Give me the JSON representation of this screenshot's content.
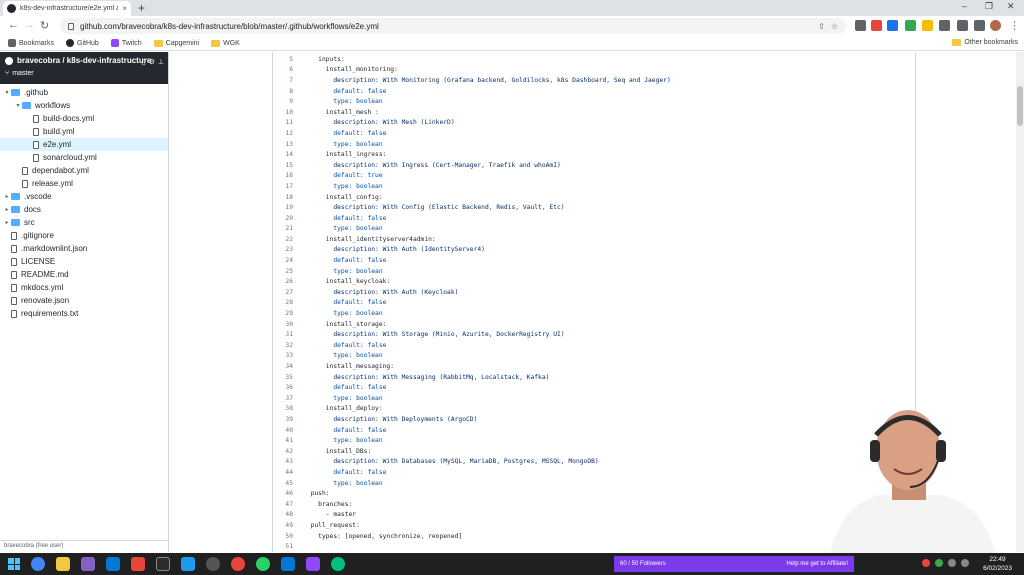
{
  "browser": {
    "tab_title": "k8s-dev-infrastructure/e2e.yml a",
    "tab_close": "×",
    "new_tab": "+",
    "url": "github.com/bravecobra/k8s-dev-infrastructure/blob/master/.github/workflows/e2e.yml",
    "bookmarks": [
      {
        "label": "Bookmarks",
        "color": "#5f6368"
      },
      {
        "label": "GitHub",
        "color": "#24292f"
      },
      {
        "label": "Twitch",
        "color": "#9146ff"
      },
      {
        "label": "Capgemini",
        "color": "#f6c744"
      },
      {
        "label": "WGK",
        "color": "#f6c744"
      }
    ],
    "other_bookmarks": "Other bookmarks"
  },
  "sidebar": {
    "repo": "bravecobra / k8s-dev-infrastructure",
    "branch": "master",
    "footer": "bravecobra (free user)",
    "tree": [
      {
        "label": ".github",
        "type": "folder",
        "depth": 0,
        "open": true
      },
      {
        "label": "workflows",
        "type": "folder",
        "depth": 1,
        "open": true
      },
      {
        "label": "build-docs.yml",
        "type": "file",
        "depth": 2
      },
      {
        "label": "build.yml",
        "type": "file",
        "depth": 2
      },
      {
        "label": "e2e.yml",
        "type": "file",
        "depth": 2,
        "selected": true
      },
      {
        "label": "sonarcloud.yml",
        "type": "file",
        "depth": 2
      },
      {
        "label": "dependabot.yml",
        "type": "file",
        "depth": 1
      },
      {
        "label": "release.yml",
        "type": "file",
        "depth": 1
      },
      {
        "label": ".vscode",
        "type": "folder",
        "depth": 0
      },
      {
        "label": "docs",
        "type": "folder",
        "depth": 0
      },
      {
        "label": "src",
        "type": "folder",
        "depth": 0
      },
      {
        "label": ".gitignore",
        "type": "file",
        "depth": 0
      },
      {
        "label": ".markdownlint.json",
        "type": "file",
        "depth": 0
      },
      {
        "label": "LICENSE",
        "type": "file",
        "depth": 0
      },
      {
        "label": "README.md",
        "type": "file",
        "depth": 0
      },
      {
        "label": "mkdocs.yml",
        "type": "file",
        "depth": 0
      },
      {
        "label": "renovate.json",
        "type": "file",
        "depth": 0
      },
      {
        "label": "requirements.txt",
        "type": "file",
        "depth": 0
      }
    ]
  },
  "code": [
    {
      "n": "5",
      "t": "    inputs:"
    },
    {
      "n": "6",
      "t": "      install_monitoring:"
    },
    {
      "n": "7",
      "t": "        description: With Monitoring (Grafana backend, Goldilocks, k8s Dashboard, Seq and Jaeger)"
    },
    {
      "n": "8",
      "t": "        default: false"
    },
    {
      "n": "9",
      "t": "        type: boolean"
    },
    {
      "n": "10",
      "t": "      install_mesh :"
    },
    {
      "n": "11",
      "t": "        description: With Mesh (LinkerD)"
    },
    {
      "n": "12",
      "t": "        default: false"
    },
    {
      "n": "13",
      "t": "        type: boolean"
    },
    {
      "n": "14",
      "t": "      install_ingress:"
    },
    {
      "n": "15",
      "t": "        description: With Ingress (Cert-Manager, Traefik and whoAmI)"
    },
    {
      "n": "16",
      "t": "        default: true"
    },
    {
      "n": "17",
      "t": "        type: boolean"
    },
    {
      "n": "18",
      "t": "      install_config:"
    },
    {
      "n": "19",
      "t": "        description: With Config (Elastic Backend, Redis, Vault, Etc)"
    },
    {
      "n": "20",
      "t": "        default: false"
    },
    {
      "n": "21",
      "t": "        type: boolean"
    },
    {
      "n": "22",
      "t": "      install_identityserver4admin:"
    },
    {
      "n": "23",
      "t": "        description: With Auth (IdentityServer4)"
    },
    {
      "n": "24",
      "t": "        default: false"
    },
    {
      "n": "25",
      "t": "        type: boolean"
    },
    {
      "n": "26",
      "t": "      install_keycloak:"
    },
    {
      "n": "27",
      "t": "        description: With Auth (Keycloak)"
    },
    {
      "n": "28",
      "t": "        default: false"
    },
    {
      "n": "29",
      "t": "        type: boolean"
    },
    {
      "n": "30",
      "t": "      install_storage:"
    },
    {
      "n": "31",
      "t": "        description: With Storage (Minio, Azurite, DockerRegistry UI)"
    },
    {
      "n": "32",
      "t": "        default: false"
    },
    {
      "n": "33",
      "t": "        type: boolean"
    },
    {
      "n": "34",
      "t": "      install_messaging:"
    },
    {
      "n": "35",
      "t": "        description: With Messaging (RabbitMq, Localstack, Kafka)"
    },
    {
      "n": "36",
      "t": "        default: false"
    },
    {
      "n": "37",
      "t": "        type: boolean"
    },
    {
      "n": "38",
      "t": "      install_deploy:"
    },
    {
      "n": "39",
      "t": "        description: With Deployments (ArgoCD)"
    },
    {
      "n": "40",
      "t": "        default: false"
    },
    {
      "n": "41",
      "t": "        type: boolean"
    },
    {
      "n": "42",
      "t": "      install_DBs:"
    },
    {
      "n": "43",
      "t": "        description: With Databases (MySQL, MariaDB, Postgres, MSSQL, MongoDB)"
    },
    {
      "n": "44",
      "t": "        default: false"
    },
    {
      "n": "45",
      "t": "        type: boolean"
    },
    {
      "n": "46",
      "t": "  push:"
    },
    {
      "n": "47",
      "t": "    branches:"
    },
    {
      "n": "48",
      "t": "      - master"
    },
    {
      "n": "49",
      "t": "  pull_request:"
    },
    {
      "n": "50",
      "t": "    types: [opened, synchronize, reopened]"
    },
    {
      "n": "51",
      "t": ""
    }
  ],
  "taskbar": {
    "notification_left": "Help me get to Affiliate!",
    "notification_right": "60 / 50 Followers",
    "time": "22:49",
    "date": "6/02/2023"
  },
  "colors": {
    "github_dark": "#24292f",
    "selected_row": "#ddf4ff",
    "folder": "#54aeff",
    "taskbar": "#202020",
    "twitch_purple": "#7c3aed"
  }
}
